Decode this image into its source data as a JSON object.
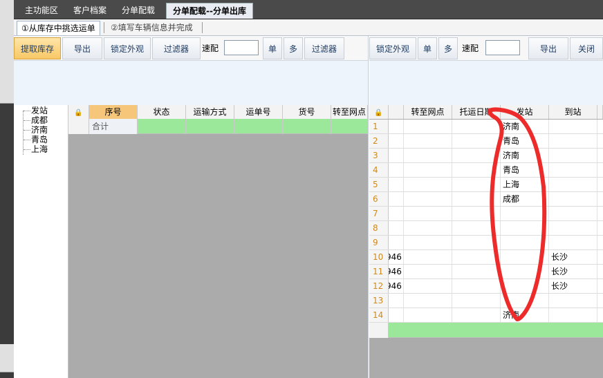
{
  "tabs": [
    "主功能区",
    "客户档案",
    "分单配载",
    "分单配载--分单出库"
  ],
  "close_symbol": "✕",
  "steps": [
    "①从库存中挑选运单",
    "②填写车辆信息并完成"
  ],
  "toolbar_left": {
    "fetch_stock": "提取库存",
    "export": "导出",
    "lock_view": "锁定外观",
    "filter": "过滤器",
    "quick_match": "速配",
    "single": "单",
    "multi": "多",
    "filter2": "过滤器"
  },
  "toolbar_right": {
    "lock_view": "锁定外观",
    "single": "单",
    "multi": "多",
    "quick_match": "速配",
    "export": "导出",
    "close": "关闭"
  },
  "tree": {
    "root": "发站",
    "children": [
      "成都",
      "济南",
      "青岛",
      "上海"
    ]
  },
  "left_grid": {
    "columns": [
      "序号",
      "状态",
      "运输方式",
      "运单号",
      "货号",
      "转至网点"
    ],
    "summary_label": "合计"
  },
  "right_grid": {
    "columns": [
      "转至网点",
      "托运日期",
      "发站",
      "到站"
    ],
    "rows": [
      {
        "n": "1",
        "a": "",
        "station": "济南",
        "to": ""
      },
      {
        "n": "2",
        "a": "",
        "station": "青岛",
        "to": ""
      },
      {
        "n": "3",
        "a": "",
        "station": "济南",
        "to": ""
      },
      {
        "n": "4",
        "a": "",
        "station": "青岛",
        "to": ""
      },
      {
        "n": "5",
        "a": "",
        "station": "上海",
        "to": ""
      },
      {
        "n": "6",
        "a": "",
        "station": "成都",
        "to": ""
      },
      {
        "n": "7",
        "a": "",
        "station": "",
        "to": ""
      },
      {
        "n": "8",
        "a": "",
        "station": "",
        "to": ""
      },
      {
        "n": "9",
        "a": "",
        "station": "",
        "to": ""
      },
      {
        "n": "10",
        "a": "946",
        "station": "",
        "to": "长沙"
      },
      {
        "n": "11",
        "a": "946",
        "station": "",
        "to": "长沙"
      },
      {
        "n": "12",
        "a": "946",
        "station": "",
        "to": "长沙"
      },
      {
        "n": "13",
        "a": "",
        "station": "",
        "to": ""
      },
      {
        "n": "14",
        "a": "",
        "station": "济南",
        "to": ""
      }
    ]
  },
  "colors": {
    "summary_green": "#9be89b",
    "row_number": "#d08a1a",
    "annotation_red": "#ee2b2b",
    "highlight_button": "#f8c866"
  },
  "icons": {
    "lock": "🔒"
  }
}
